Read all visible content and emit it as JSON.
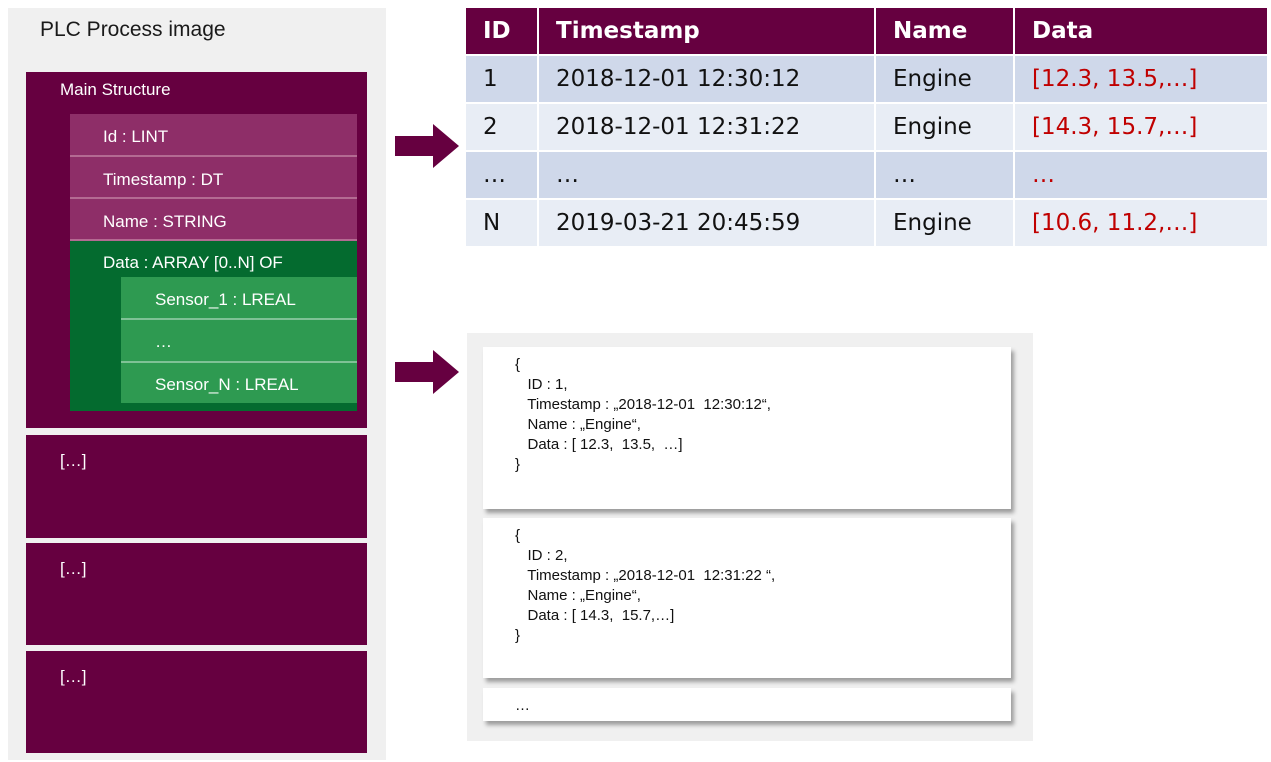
{
  "plc": {
    "title": "PLC Process image",
    "main_structure": {
      "label": "Main Structure",
      "fields": [
        "Id : LINT",
        "Timestamp : DT",
        "Name : STRING"
      ],
      "data_field": "Data : ARRAY [0..N] OF",
      "sensors": [
        "Sensor_1 : LREAL",
        "…",
        "Sensor_N : LREAL"
      ]
    },
    "more_blocks": [
      "[…]",
      "[…]",
      "[…]"
    ]
  },
  "table": {
    "headers": [
      "ID",
      "Timestamp",
      "Name",
      "Data"
    ],
    "rows": [
      [
        "1",
        "2018-12-01 12:30:12",
        "Engine",
        "[12.3, 13.5,…]"
      ],
      [
        "2",
        "2018-12-01 12:31:22",
        "Engine",
        "[14.3, 15.7,…]"
      ],
      [
        "…",
        "…",
        "…",
        "…"
      ],
      [
        "N",
        "2019-03-21 20:45:59",
        "Engine",
        "[10.6, 11.2,…]"
      ]
    ]
  },
  "json_docs": [
    {
      "lines": [
        "{",
        "   ID : 1,",
        "   Timestamp : „2018-12-01  12:30:12“,",
        "   Name : „Engine“,",
        "   Data : [ 12.3,  13.5,  …]",
        "}"
      ]
    },
    {
      "lines": [
        "{",
        "   ID : 2,",
        "   Timestamp : „2018-12-01  12:31:22 “,",
        "   Name : „Engine“,",
        "   Data : [ 14.3,  15.7,…]",
        "}"
      ]
    }
  ],
  "json_more": "…",
  "colors": {
    "maroon": "#660040",
    "pink": "#8e2e68",
    "green_dark": "#046b2f",
    "green_light": "#2e9a51",
    "data_red": "#c00000"
  }
}
